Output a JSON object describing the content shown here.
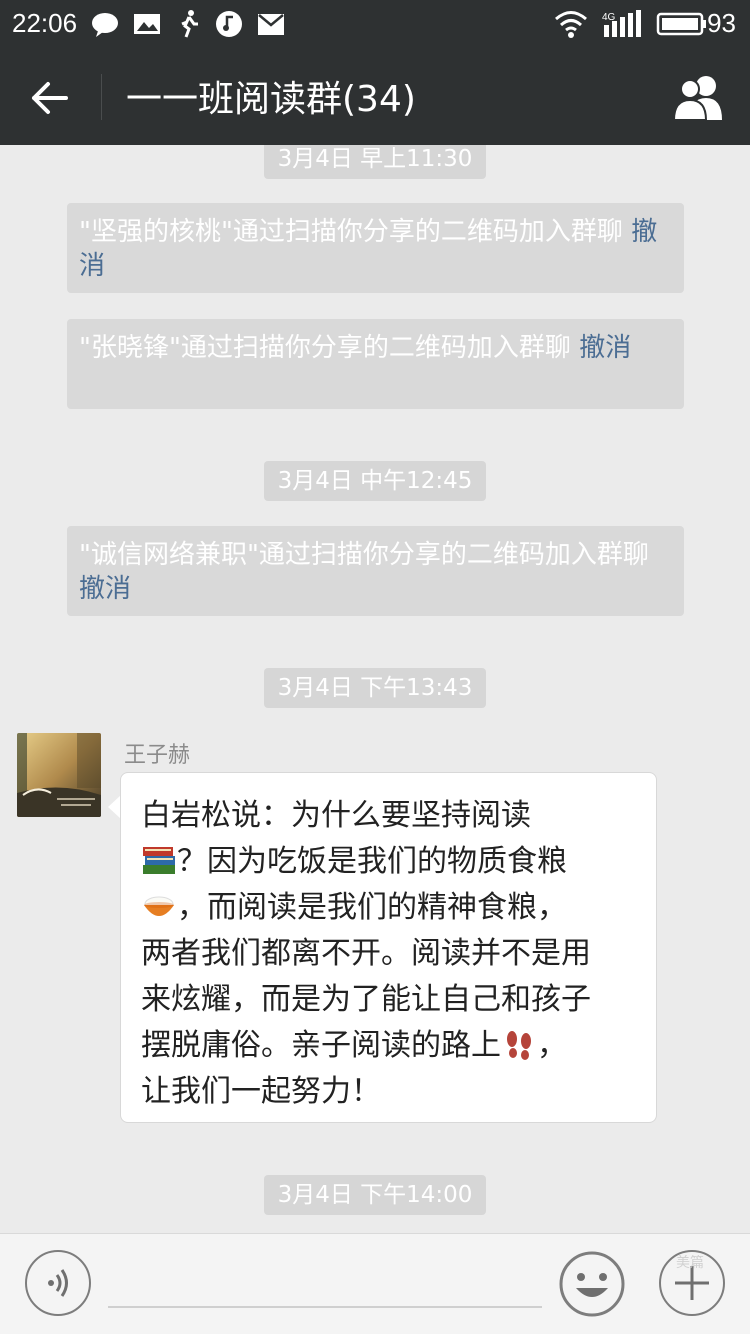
{
  "status_bar": {
    "time": "22:06",
    "network": "4G",
    "battery": "93"
  },
  "header": {
    "title": "一一班阅读群(34)"
  },
  "messages": [
    {
      "type": "time",
      "text": "3月4日 早上11:30"
    },
    {
      "type": "system",
      "text": "\"坚强的核桃\"通过扫描你分享的二维码加入群聊",
      "action": "撤消"
    },
    {
      "type": "system",
      "text": "\"张晓锋\"通过扫描你分享的二维码加入群聊",
      "action": "撤消"
    },
    {
      "type": "time",
      "text": "3月4日 中午12:45"
    },
    {
      "type": "system",
      "text": "\"诚信网络兼职\"通过扫描你分享的二维码加入群聊",
      "action": "撤消"
    },
    {
      "type": "time",
      "text": "3月4日 下午13:43"
    },
    {
      "type": "chat",
      "sender": "王子赫",
      "lines": [
        "白岩松说：为什么要坚持阅读",
        "？因为吃饭是我们的物质食粮",
        "，而阅读是我们的精神食粮，",
        "两者我们都离不开。阅读并不是用",
        "来炫耀，而是为了能让自己和孩子",
        "摆脱庸俗。亲子阅读的路上",
        "，",
        "让我们一起努力！"
      ]
    },
    {
      "type": "time",
      "text": "3月4日 下午14:00"
    }
  ],
  "watermark": "美篇",
  "icons": [
    "back-arrow-icon",
    "group-members-icon",
    "voice-icon",
    "emoji-icon",
    "plus-icon",
    "books-emoji",
    "rice-bowl-emoji",
    "footprints-emoji"
  ]
}
